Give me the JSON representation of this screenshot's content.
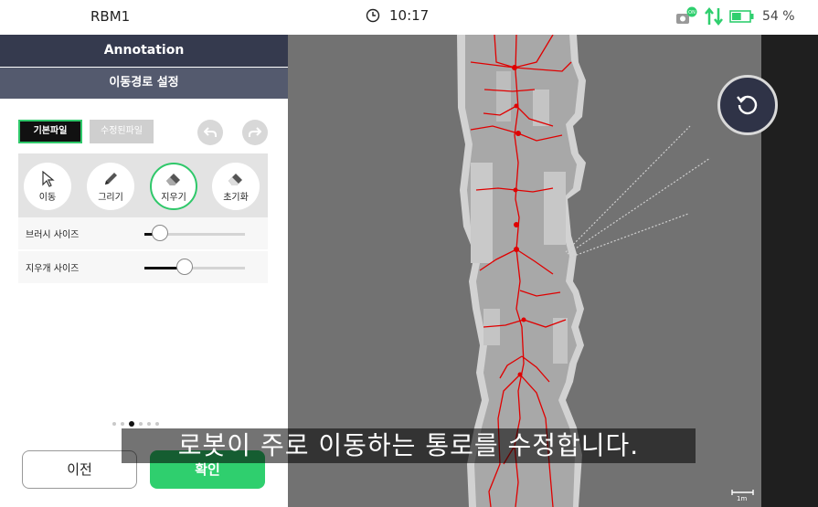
{
  "status_bar": {
    "device_name": "RBM1",
    "time": "10:17",
    "battery_percent": "54 %",
    "battery_level": 0.54,
    "icons": [
      "clock-icon",
      "camera-on-icon",
      "data-transfer-icon",
      "battery-icon"
    ],
    "camera_badge": "ON"
  },
  "panel": {
    "title": "Annotation",
    "subtitle": "이동경로 설정",
    "file_tabs": {
      "default": "기본파일",
      "modified": "수정된파일"
    },
    "tools": [
      {
        "label": "이동",
        "icon": "cursor-icon"
      },
      {
        "label": "그리기",
        "icon": "pencil-icon"
      },
      {
        "label": "지우기",
        "icon": "eraser-icon"
      },
      {
        "label": "초기화",
        "icon": "clear-eraser-icon"
      }
    ],
    "selected_tool": "지우기",
    "brush_size": {
      "label": "브러시 사이즈",
      "value": 0.15
    },
    "eraser_size": {
      "label": "지우개 사이즈",
      "value": 0.4
    },
    "pages": {
      "count": 6,
      "current": 3
    },
    "prev_label": "이전",
    "confirm_label": "확인"
  },
  "map": {
    "scale_label": "1m"
  },
  "caption": "로봇이 주로 이동하는 통로를 수정합니다.",
  "colors": {
    "accent": "#2fcf6e",
    "header": "#353a4e",
    "subheader": "#545a6e",
    "path": "#e00000",
    "map_unknown": "#727272",
    "map_free": "#a8a8a8"
  }
}
